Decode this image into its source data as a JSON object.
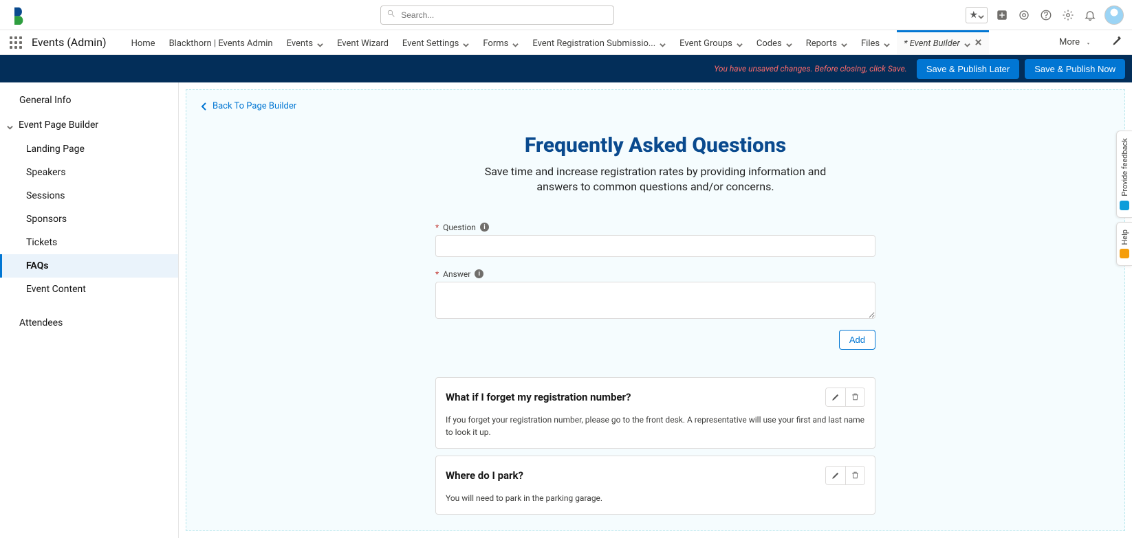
{
  "global": {
    "search_placeholder": "Search...",
    "favorites": "favorites",
    "icons": [
      "plus",
      "target",
      "question",
      "gear",
      "bell"
    ]
  },
  "nav": {
    "app_name": "Events (Admin)",
    "items": [
      {
        "label": "Home",
        "menu": false
      },
      {
        "label": "Blackthorn | Events Admin",
        "menu": false
      },
      {
        "label": "Events",
        "menu": true
      },
      {
        "label": "Event Wizard",
        "menu": false
      },
      {
        "label": "Event Settings",
        "menu": true
      },
      {
        "label": "Forms",
        "menu": true
      },
      {
        "label": "Event Registration Submissio...",
        "menu": true
      },
      {
        "label": "Event Groups",
        "menu": true
      },
      {
        "label": "Codes",
        "menu": true
      },
      {
        "label": "Reports",
        "menu": true
      },
      {
        "label": "Files",
        "menu": true
      }
    ],
    "active_tab": "* Event Builder",
    "more": "More"
  },
  "action_bar": {
    "unsaved_msg": "You have unsaved changes. Before closing, click Save.",
    "save_later": "Save & Publish Later",
    "save_now": "Save & Publish Now"
  },
  "sidebar": {
    "general_info": "General Info",
    "builder_parent": "Event Page Builder",
    "children": [
      "Landing Page",
      "Speakers",
      "Sessions",
      "Sponsors",
      "Tickets",
      "FAQs",
      "Event Content"
    ],
    "selected_index": 5,
    "attendees": "Attendees"
  },
  "canvas": {
    "back": "Back To Page Builder",
    "title": "Frequently Asked Questions",
    "subtitle": "Save time and increase registration rates by providing information and answers to common questions and/or concerns.",
    "question_label": "Question",
    "answer_label": "Answer",
    "add": "Add",
    "faqs": [
      {
        "q": "What if I forget my registration number?",
        "a": "If you forget your registration number, please go to the front desk. A representative will use your first and last name to look it up."
      },
      {
        "q": "Where do I park?",
        "a": "You will need to park in the parking garage."
      }
    ]
  },
  "dock": {
    "feedback": "Provide feedback",
    "help": "Help"
  }
}
